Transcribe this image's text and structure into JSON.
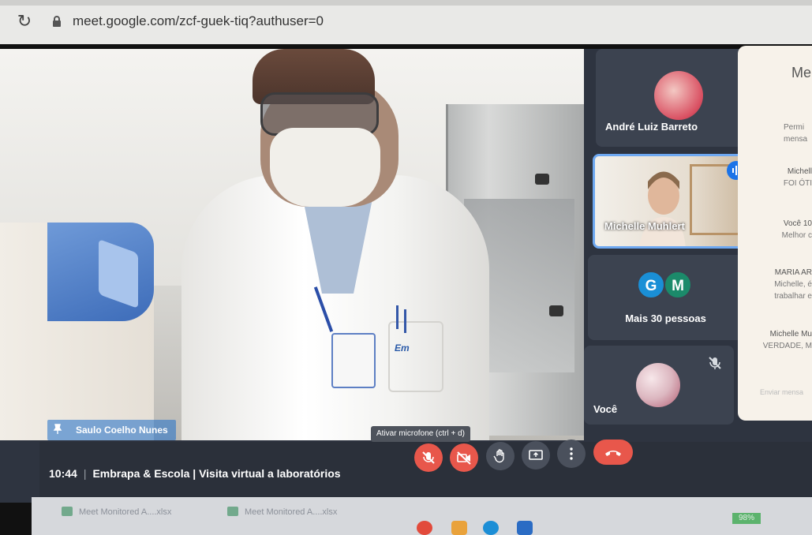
{
  "browser": {
    "url": "meet.google.com/zcf-guek-tiq?authuser=0"
  },
  "main_video": {
    "presenter_name": "Saulo Coelho Nunes",
    "badge_logo_text": "Em"
  },
  "participants": [
    {
      "name": "André Luiz Barreto",
      "muted": true
    },
    {
      "name": "Michelle Muhlert",
      "speaking": true
    },
    {
      "name": "Mais 30 pessoas",
      "initials": [
        "G",
        "M"
      ],
      "initial_colors": [
        "#1a8fd6",
        "#1b8a6a"
      ]
    },
    {
      "name": "Você",
      "muted": true
    }
  ],
  "chat": {
    "title": "Me",
    "info_line1": "Permi",
    "info_line2": "mensa",
    "messages": [
      {
        "author": "Michell",
        "text": "FOI ÓTI"
      },
      {
        "author": "Você 10",
        "text": "Melhor c"
      },
      {
        "author": "MARIA AR",
        "text": "Michelle, é",
        "text2": "trabalhar e"
      },
      {
        "author": "Michelle Mu",
        "text": "VERDADE, M"
      }
    ],
    "compose_placeholder": "Enviar mensa"
  },
  "meeting_bar": {
    "time": "10:44",
    "separator": "|",
    "title": "Embrapa & Escola | Visita virtual a laboratórios",
    "tooltip": "Ativar microfone (ctrl + d)"
  },
  "taskbar": {
    "downloads": [
      "Meet Monitored A....xlsx",
      "Meet Monitored A....xlsx"
    ],
    "battery": "98%"
  },
  "colors": {
    "accent": "#1a73e8",
    "danger": "#e8574b",
    "tile_bg": "#3c4350",
    "bar_bg": "#2b303a"
  }
}
